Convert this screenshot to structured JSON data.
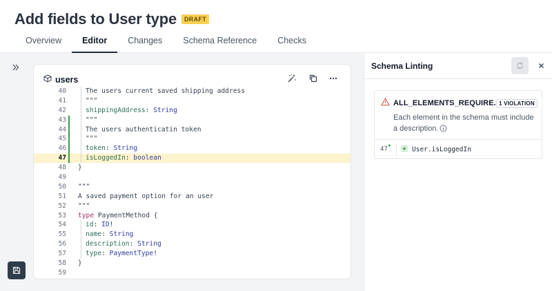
{
  "header": {
    "title": "Add fields to User type",
    "badge": "DRAFT",
    "tabs": [
      {
        "label": "Overview"
      },
      {
        "label": "Editor"
      },
      {
        "label": "Changes"
      },
      {
        "label": "Schema Reference"
      },
      {
        "label": "Checks"
      }
    ],
    "active_tab": "Editor"
  },
  "editor": {
    "file_name": "users",
    "icons": [
      "cube-icon",
      "magic-wand-icon",
      "copy-icon",
      "more-icon"
    ],
    "lines": [
      {
        "n": "40",
        "text": "The users current saved shipping address"
      },
      {
        "n": "41",
        "text": "\"\"\""
      },
      {
        "n": "42",
        "prop": "shippingAddress",
        "type": "String"
      },
      {
        "n": "43",
        "text": "\"\"\""
      },
      {
        "n": "44",
        "text": "The users authenticatin token"
      },
      {
        "n": "45",
        "text": "\"\"\""
      },
      {
        "n": "46",
        "prop": "token",
        "type": "String"
      },
      {
        "n": "47",
        "prop": "isLoggedIn",
        "type": "boolean"
      },
      {
        "n": "48",
        "text": "}"
      },
      {
        "n": "49",
        "text": ""
      },
      {
        "n": "50",
        "text": "\"\"\""
      },
      {
        "n": "51",
        "text": "A saved payment option for an user"
      },
      {
        "n": "52",
        "text": "\"\"\""
      },
      {
        "n": "53",
        "keyword": "type",
        "name": "PaymentMethod",
        "rest": " {"
      },
      {
        "n": "54",
        "prop": "id",
        "type": "ID!"
      },
      {
        "n": "55",
        "prop": "name",
        "type": "String"
      },
      {
        "n": "56",
        "prop": "description",
        "type": "String"
      },
      {
        "n": "57",
        "prop": "type",
        "type": "PaymentType!"
      },
      {
        "n": "58",
        "text": "}"
      },
      {
        "n": "59",
        "text": ""
      }
    ]
  },
  "panel": {
    "title": "Schema Linting",
    "rule": "ALL_ELEMENTS_REQUIRE...",
    "violation_count": "1 VIOLATION",
    "description": "Each element in the schema must include a description.",
    "row_line": "47",
    "row_code": "User.isLoggedIn",
    "row_marker": "+"
  },
  "colors": {
    "accent": "#2f3d4b",
    "badge_bg": "#f7d154",
    "added_marker": "#3c9a4a",
    "highlight_line": "#fdf3cd",
    "warning": "#d9534f"
  }
}
